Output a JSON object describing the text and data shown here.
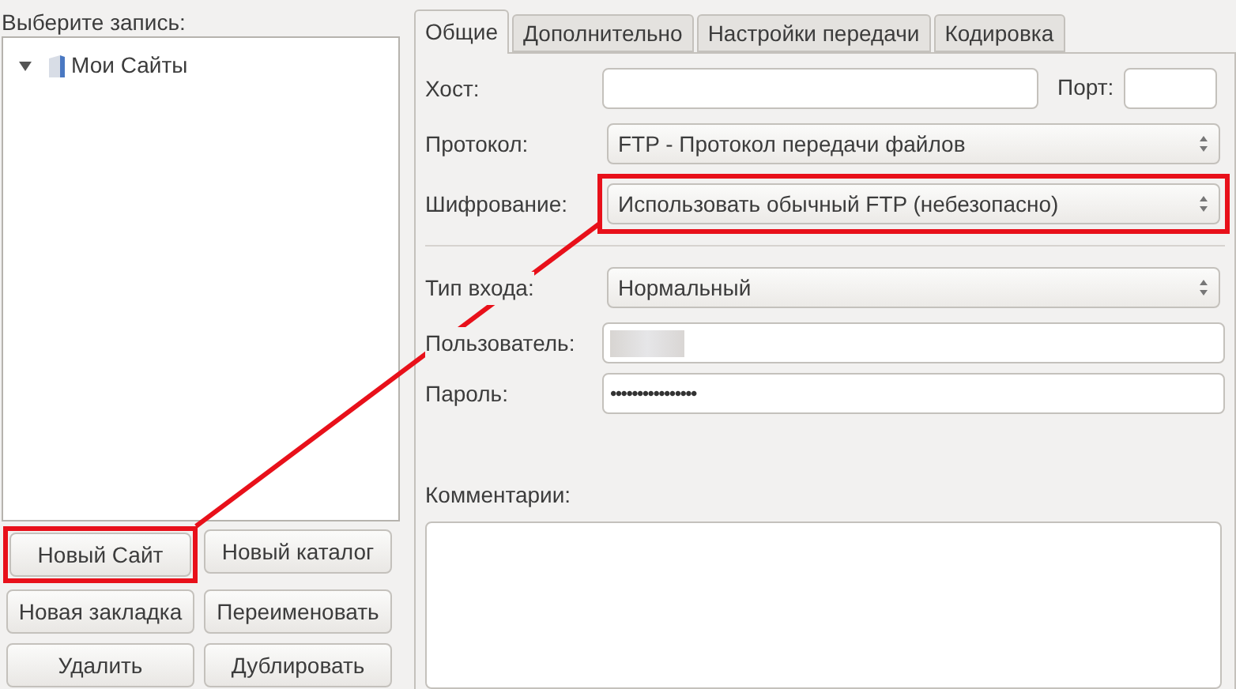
{
  "left": {
    "label": "Выберите запись:",
    "tree": [
      {
        "label": "Мои Сайты",
        "expanded": true
      }
    ],
    "buttons": [
      {
        "label": "Новый Сайт",
        "highlighted": true
      },
      {
        "label": "Новый каталог",
        "highlighted": false
      },
      {
        "label": "Новая закладка",
        "highlighted": false
      },
      {
        "label": "Переименовать",
        "highlighted": false
      },
      {
        "label": "Удалить",
        "highlighted": false
      },
      {
        "label": "Дублировать",
        "highlighted": false
      }
    ]
  },
  "tabs": [
    {
      "label": "Общие",
      "selected": true
    },
    {
      "label": "Дополнительно",
      "selected": false
    },
    {
      "label": "Настройки передачи",
      "selected": false
    },
    {
      "label": "Кодировка",
      "selected": false
    }
  ],
  "host": {
    "label": "Хост:"
  },
  "port": {
    "label": "Порт:"
  },
  "protocol": {
    "label": "Протокол:",
    "value": "FTP - Протокол передачи файлов",
    "highlighted": false
  },
  "encryption": {
    "label": "Шифрование:",
    "value": "Использовать обычный FTP (небезопасно)",
    "highlighted": true
  },
  "logon_type": {
    "label": "Тип входа:",
    "value": "Нормальный",
    "highlighted": false
  },
  "user": {
    "label": "Пользователь:",
    "redacted": true
  },
  "password": {
    "label": "Пароль:",
    "value": "••••••••••••••••"
  },
  "comments": {
    "label": "Комментарии:"
  }
}
